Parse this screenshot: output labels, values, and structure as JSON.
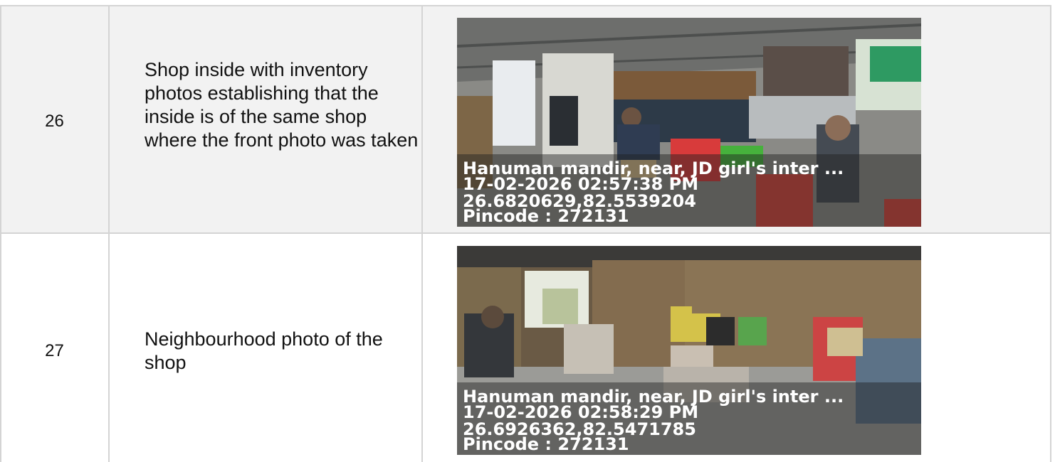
{
  "rows": [
    {
      "number": "26",
      "description": "Shop inside with inventory photos establishing that the inside is of the same shop where the front photo was taken",
      "photo": {
        "address": "Hanuman mandir, near, JD girl's inter ...",
        "datetime": "17-02-2026 02:57:38 PM",
        "coords": "26.6820629,82.5539204",
        "pincode": "Pincode : 272131"
      }
    },
    {
      "number": "27",
      "description": "Neighbourhood photo of the shop",
      "photo": {
        "address": "Hanuman mandir, near, JD girl's inter ...",
        "datetime": "17-02-2026 02:58:29 PM",
        "coords": "26.6926362,82.5471785",
        "pincode": "Pincode : 272131"
      }
    }
  ]
}
